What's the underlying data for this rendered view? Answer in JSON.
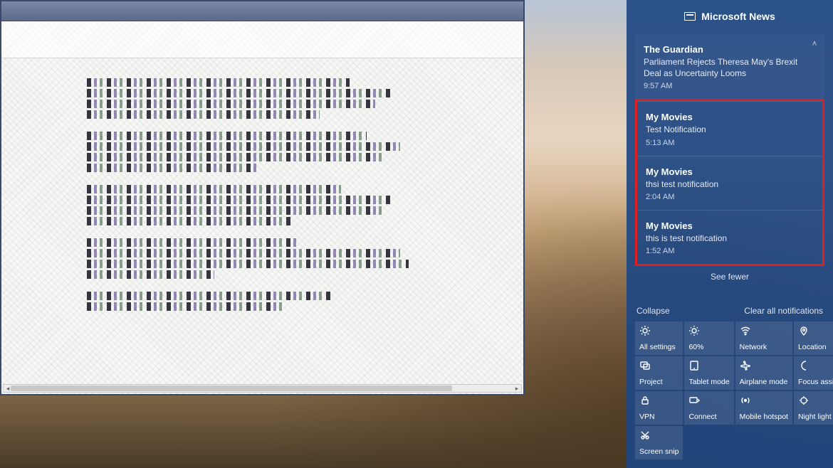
{
  "action_center": {
    "header": {
      "title": "Microsoft News"
    },
    "news_card": {
      "source": "The Guardian",
      "headline": "Parliament Rejects Theresa May's Brexit Deal as Uncertainty Looms",
      "time": "9:57 AM"
    },
    "highlighted": [
      {
        "app": "My Movies",
        "body": "Test Notification",
        "time": "5:13 AM"
      },
      {
        "app": "My Movies",
        "body": "thsi test notification",
        "time": "2:04 AM"
      },
      {
        "app": "My Movies",
        "body": "this is test notification",
        "time": "1:52 AM"
      }
    ],
    "see_fewer": "See fewer",
    "collapse": "Collapse",
    "clear_all": "Clear all notifications",
    "quick_actions": [
      {
        "name": "all-settings",
        "label": "All settings",
        "icon": "gear"
      },
      {
        "name": "brightness",
        "label": "60%",
        "icon": "sun"
      },
      {
        "name": "network",
        "label": "Network",
        "icon": "wifi"
      },
      {
        "name": "location",
        "label": "Location",
        "icon": "pin"
      },
      {
        "name": "project",
        "label": "Project",
        "icon": "project"
      },
      {
        "name": "tablet-mode",
        "label": "Tablet mode",
        "icon": "tablet"
      },
      {
        "name": "airplane-mode",
        "label": "Airplane mode",
        "icon": "plane"
      },
      {
        "name": "focus-assist",
        "label": "Focus assist",
        "icon": "moon"
      },
      {
        "name": "vpn",
        "label": "VPN",
        "icon": "vpn"
      },
      {
        "name": "connect",
        "label": "Connect",
        "icon": "connect"
      },
      {
        "name": "mobile-hotspot",
        "label": "Mobile hotspot",
        "icon": "hotspot"
      },
      {
        "name": "night-light",
        "label": "Night light",
        "icon": "nightlight"
      },
      {
        "name": "screen-snip",
        "label": "Screen snip",
        "icon": "snip"
      }
    ]
  }
}
